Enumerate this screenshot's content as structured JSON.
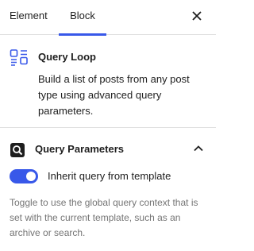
{
  "tabs": {
    "element": "Element",
    "block": "Block"
  },
  "icons": {
    "close": "close-icon",
    "block": "query-loop-icon",
    "panel": "query-params-icon",
    "chevron": "chevron-up-icon"
  },
  "block": {
    "title": "Query Loop",
    "description": "Build a list of posts from any post type using advanced query parameters."
  },
  "panel": {
    "title": "Query Parameters",
    "toggle_label": "Inherit query from template",
    "toggle_on": true,
    "help": "Toggle to use the global query context that is set with the current template, such as an archive or search."
  },
  "colors": {
    "accent": "#3858e9",
    "text": "#1e1e1e",
    "muted": "#757575",
    "divider": "#e0e0e0"
  }
}
